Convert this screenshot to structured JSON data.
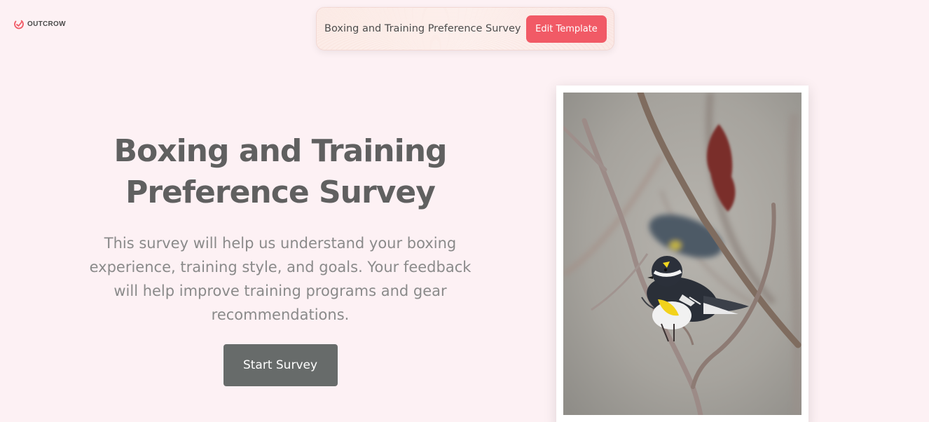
{
  "brand": {
    "logo_text": "OUTCROW",
    "accent_color": "#f15a66"
  },
  "template_bar": {
    "title": "Boxing and Training Preference Survey",
    "edit_label": "Edit Template"
  },
  "hero": {
    "title_line1": "Boxing and Training",
    "title_line2": "Preference Survey",
    "description": "This survey will help us understand your boxing experience, training style, and goals. Your feedback will help improve training programs and gear recommendations.",
    "start_label": "Start Survey"
  },
  "image": {
    "subject": "bird-on-branch-photo"
  }
}
